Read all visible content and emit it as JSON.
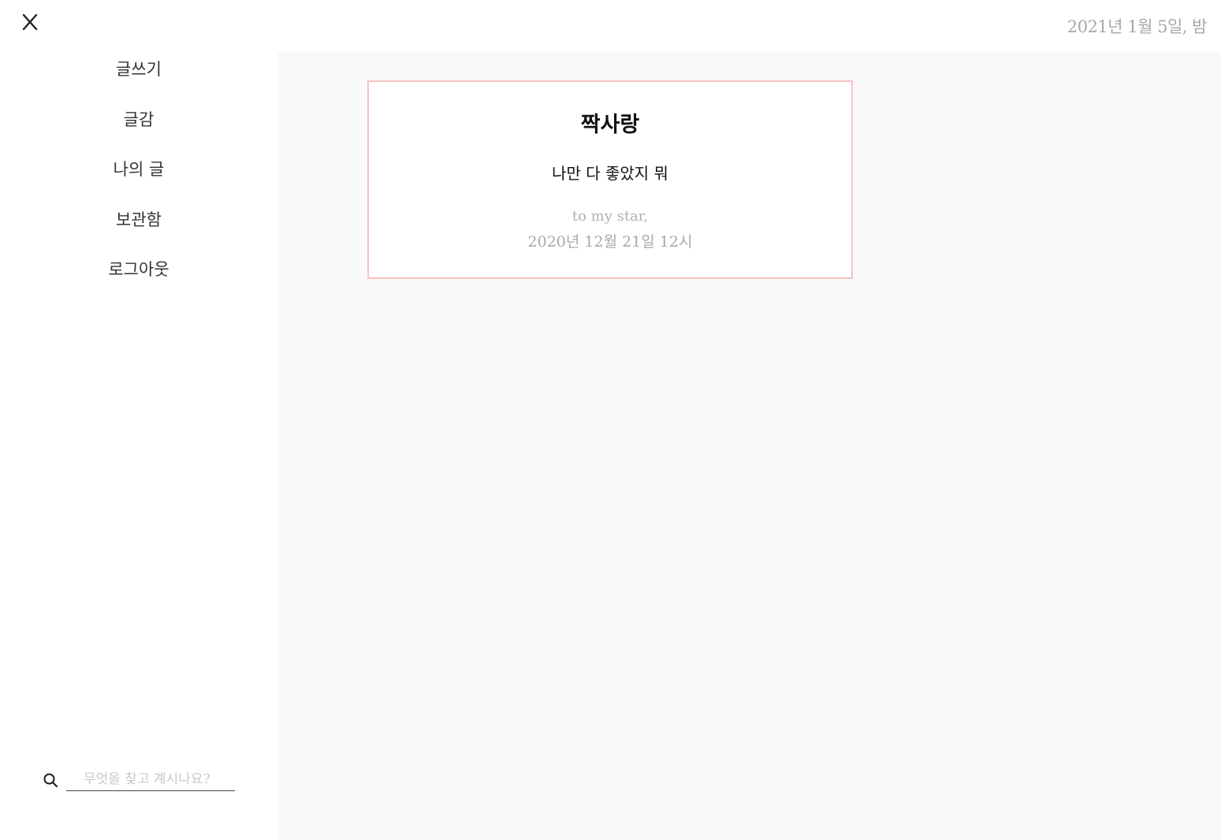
{
  "header": {
    "close_icon": "close-icon",
    "date": "2021년 1월 5일, 밤"
  },
  "sidebar": {
    "items": [
      {
        "label": "글쓰기"
      },
      {
        "label": "글감"
      },
      {
        "label": "나의 글"
      },
      {
        "label": "보관함"
      },
      {
        "label": "로그아웃"
      }
    ],
    "search": {
      "icon": "search-icon",
      "placeholder": "무엇을 찾고 계시나요?",
      "value": ""
    }
  },
  "main": {
    "cards": [
      {
        "title": "짝사랑",
        "body": "나만 다 좋았지 뭐",
        "to": "to my star,",
        "date": "2020년 12월 21일 12시"
      }
    ]
  },
  "colors": {
    "card_border": "#f8c1c6",
    "main_background": "#f9f9f9",
    "muted_text": "#a8a8a8"
  }
}
